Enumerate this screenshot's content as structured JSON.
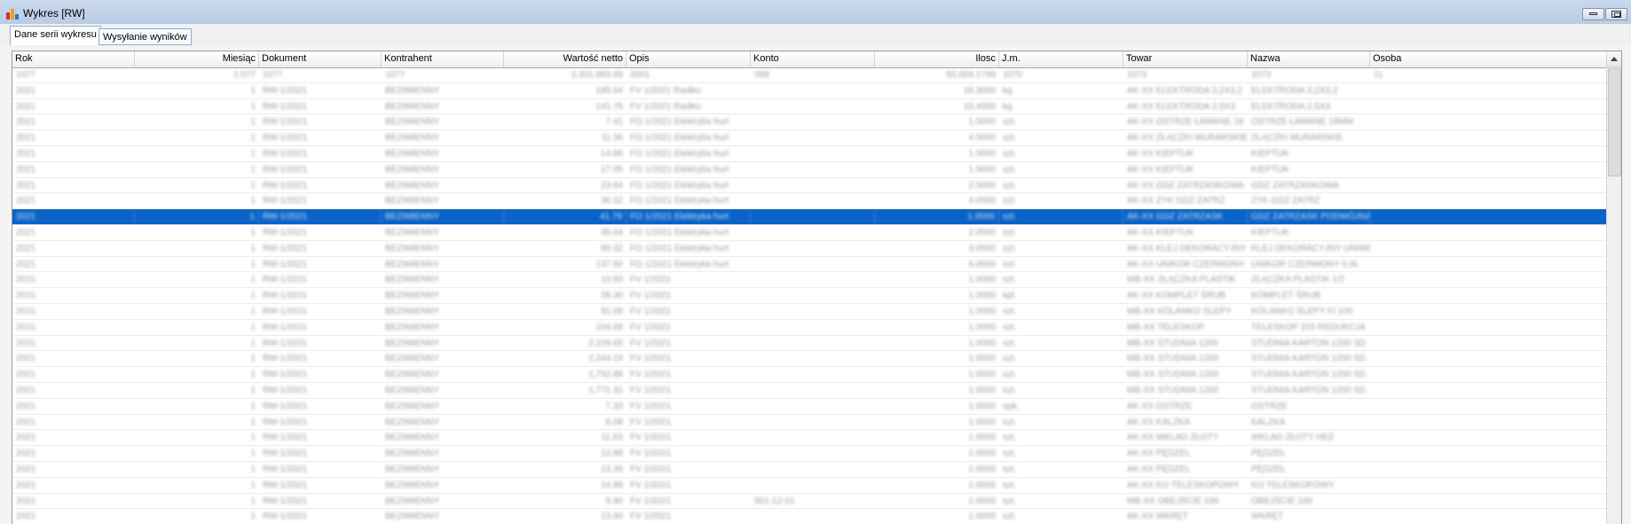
{
  "window": {
    "title": "Wykres [RW]"
  },
  "tabs": [
    {
      "label": "Dane serii wykresu",
      "active": true
    },
    {
      "label": "Wysyłanie wyników",
      "active": false
    }
  ],
  "columns": [
    {
      "key": "rok",
      "label": "Rok"
    },
    {
      "key": "miesiac",
      "label": "Miesiąc"
    },
    {
      "key": "dokument",
      "label": "Dokument"
    },
    {
      "key": "kontrahent",
      "label": "Kontrahent"
    },
    {
      "key": "wartosc",
      "label": "Wartość netto"
    },
    {
      "key": "opis",
      "label": "Opis"
    },
    {
      "key": "konto",
      "label": "Konto"
    },
    {
      "key": "ilosc",
      "label": "Ilosc"
    },
    {
      "key": "jm",
      "label": "J.m."
    },
    {
      "key": "towar",
      "label": "Towar"
    },
    {
      "key": "nazwa",
      "label": "Nazwa"
    },
    {
      "key": "osoba",
      "label": "Osoba"
    }
  ],
  "rows": [
    [
      "1077",
      "1.077",
      "1077",
      "1077",
      "2,331,983.49",
      "2001",
      "098",
      "92,004.1749",
      "1070",
      "1073",
      "1073",
      "11"
    ],
    [
      "2021",
      "1",
      "RW-1/2021",
      "BEZIMIENNY",
      "185.54",
      "FV 1/2021 Radiko",
      "",
      "16.3000",
      "kg",
      "AK-XX ELEKTRODA 3,2X3,2",
      "ELEKTRODA 3,2X3,2",
      ""
    ],
    [
      "2021",
      "1",
      "RW-1/2021",
      "BEZIMIENNY",
      "141.75",
      "FV 1/2021 Radiko",
      "",
      "15.4000",
      "kg",
      "AK-XX ELEKTRODA 2,5X3",
      "ELEKTRODA 2,5X3",
      ""
    ],
    [
      "2021",
      "1",
      "RW-1/2021",
      "BEZIMIENNY",
      "7.41",
      "FO 1/2021 Elektryka hurt",
      "",
      "1.0000",
      "szt.",
      "AK-XX OSTRZE ŁAMANE 18",
      "OSTRZE ŁAMANE 18MM",
      ""
    ],
    [
      "2021",
      "1",
      "RW-1/2021",
      "BEZIMIENNY",
      "11.36",
      "FO 1/2021 Elektryka hurt",
      "",
      "4.0000",
      "szt.",
      "AK-XX ZŁĄCZKI MURARSKIE",
      "ZŁĄCZKI MURARSKIE",
      ""
    ],
    [
      "2021",
      "1",
      "RW-1/2021",
      "BEZIMIENNY",
      "14.86",
      "FO 1/2021 Elektryka hurt",
      "",
      "1.0000",
      "szt.",
      "AK-XX KIEPTUK",
      "KIEPTUK",
      ""
    ],
    [
      "2021",
      "1",
      "RW-1/2021",
      "BEZIMIENNY",
      "17.05",
      "FO 1/2021 Elektryka hurt",
      "",
      "1.0000",
      "szt.",
      "AK-XX KIEPTUK",
      "KIEPTUK",
      ""
    ],
    [
      "2021",
      "1",
      "RW-1/2021",
      "BEZIMIENNY",
      "23.64",
      "FO 1/2021 Elektryka hurt",
      "",
      "2.0000",
      "szt.",
      "AK-XX GDZ ZATRZASKOWA",
      "GDZ ZATRZASKOWA",
      ""
    ],
    [
      "2021",
      "1",
      "RW-1/2021",
      "BEZIMIENNY",
      "36.32",
      "FO 1/2021 Elektryka hurt",
      "",
      "4.0000",
      "szt.",
      "AK-XX ZYK GDZ ZATRZ",
      "ZYK GDZ ZATRZ",
      ""
    ],
    [
      "2021",
      "1",
      "RW-1/2021",
      "BEZIMIENNY",
      "41.79",
      "FO 1/2021 Elektryka hurt",
      "",
      "1.0000",
      "szt.",
      "AK-XX GDZ ZATRZASK",
      "GDZ ZATRZASK PODWÓJNA",
      ""
    ],
    [
      "2021",
      "1",
      "RW-1/2021",
      "BEZIMIENNY",
      "35.64",
      "FO 1/2021 Elektryka hurt",
      "",
      "2.0000",
      "szt.",
      "AK-XX KIEPTUK",
      "KIEPTUK",
      ""
    ],
    [
      "2021",
      "1",
      "RW-1/2021",
      "BEZIMIENNY",
      "89.32",
      "FO 1/2021 Elektryka hurt",
      "",
      "3.0000",
      "szt.",
      "AK-XX KLEJ DEKORACYJNY",
      "KLEJ DEKORACYJNY UNIWERSAL",
      ""
    ],
    [
      "2021",
      "1",
      "RW-1/2021",
      "BEZIMIENNY",
      "137.92",
      "FO 1/2021 Elektryka hurt",
      "",
      "6.0000",
      "szt.",
      "AK-XX UNIKOR CZERWONY",
      "UNIKOR CZERWONY 0,9L",
      ""
    ],
    [
      "2021",
      "1",
      "RW-1/2021",
      "BEZIMIENNY",
      "10.93",
      "FV 1/2021",
      "",
      "1.0000",
      "szt.",
      "MB-XX ZŁĄCZKA PLASTIK",
      "ZŁĄCZKA PLASTIK 1/2",
      ""
    ],
    [
      "2021",
      "1",
      "RW-1/2021",
      "BEZIMIENNY",
      "28.30",
      "FV 1/2021",
      "",
      "1.0000",
      "kpl.",
      "AK-XX KOMPLET ŚRUB",
      "KOMPLET ŚRUB",
      ""
    ],
    [
      "2021",
      "1",
      "RW-1/2021",
      "BEZIMIENNY",
      "91.09",
      "FV 1/2021",
      "",
      "1.0000",
      "szt.",
      "MB-XX KOLANKO SLEPY",
      "KOLANKO SLEPY FI 100",
      ""
    ],
    [
      "2021",
      "1",
      "RW-1/2021",
      "BEZIMIENNY",
      "104.99",
      "FV 1/2021",
      "",
      "1.0000",
      "szt.",
      "MB-XX TELESKOP",
      "TELESKOP 315 REDUKCJA",
      ""
    ],
    [
      "2021",
      "1",
      "RW-1/2021",
      "BEZIMIENNY",
      "2,109.65",
      "FV 1/2021",
      "",
      "1.0000",
      "szt.",
      "MB-XX STUDNIA 1200",
      "STUDNIA KARTON 1200 SD",
      ""
    ],
    [
      "2021",
      "1",
      "RW-1/2021",
      "BEZIMIENNY",
      "2,244.19",
      "FV 1/2021",
      "",
      "1.0000",
      "szt.",
      "MB-XX STUDNIA 1200",
      "STUDNIA KARTON 1200 SD",
      ""
    ],
    [
      "2021",
      "1",
      "RW-1/2021",
      "BEZIMIENNY",
      "1,752.88",
      "FV 1/2021",
      "",
      "1.0000",
      "szt.",
      "MB-XX STUDNIA 1200",
      "STUDNIA KARTON 1200 SD",
      ""
    ],
    [
      "2021",
      "1",
      "RW-1/2021",
      "BEZIMIENNY",
      "1,771.31",
      "FV 1/2021",
      "",
      "1.0000",
      "szt.",
      "MB-XX STUDNIA 1200",
      "STUDNIA KARTON 1200 SD",
      ""
    ],
    [
      "2021",
      "1",
      "RW-1/2021",
      "BEZIMIENNY",
      "7.33",
      "FV 1/2021",
      "",
      "1.0000",
      "opk.",
      "AK-XX OSTRZE",
      "OSTRZE",
      ""
    ],
    [
      "2021",
      "1",
      "RW-1/2021",
      "BEZIMIENNY",
      "8.08",
      "FV 1/2021",
      "",
      "1.0000",
      "szt.",
      "AK-XX KALZKA",
      "KALZKA",
      ""
    ],
    [
      "2021",
      "1",
      "RW-1/2021",
      "BEZIMIENNY",
      "11.63",
      "FV 1/2021",
      "",
      "1.0000",
      "szt.",
      "AK-XX WKLAD ZŁOTY",
      "WKLAD ZŁOTY HEŻ",
      ""
    ],
    [
      "2021",
      "1",
      "RW-1/2021",
      "BEZIMIENNY",
      "12.88",
      "FV 1/2021",
      "",
      "2.0000",
      "szt.",
      "AK-XX PĘDZEL",
      "PĘDZEL",
      ""
    ],
    [
      "2021",
      "1",
      "RW-1/2021",
      "BEZIMIENNY",
      "13.39",
      "FV 1/2021",
      "",
      "1.0000",
      "szt.",
      "AK-XX PĘDZEL",
      "PĘDZEL",
      ""
    ],
    [
      "2021",
      "1",
      "RW-1/2021",
      "BEZIMIENNY",
      "14.89",
      "FV 1/2021",
      "",
      "1.0000",
      "szt.",
      "AK-XX KIJ TELESKOPOWY",
      "KIJ TELESKOPOWY",
      ""
    ],
    [
      "2021",
      "1",
      "RW-1/2021",
      "BEZIMIENNY",
      "9.90",
      "FV 1/2021",
      "501-12-01",
      "1.0000",
      "szt.",
      "MB-XX OBEJŚCIE 100",
      "OBEJŚCIE 100",
      ""
    ],
    [
      "2021",
      "1",
      "RW-1/2021",
      "BEZIMIENNY",
      "13.60",
      "FV 1/2021",
      "",
      "1.0000",
      "szt.",
      "AK-XX WKRĘT",
      "WKRĘT",
      ""
    ]
  ],
  "selected_row": 9,
  "colors": {
    "selection": "#0a64c8",
    "titlebar": "#c3d4ea"
  }
}
